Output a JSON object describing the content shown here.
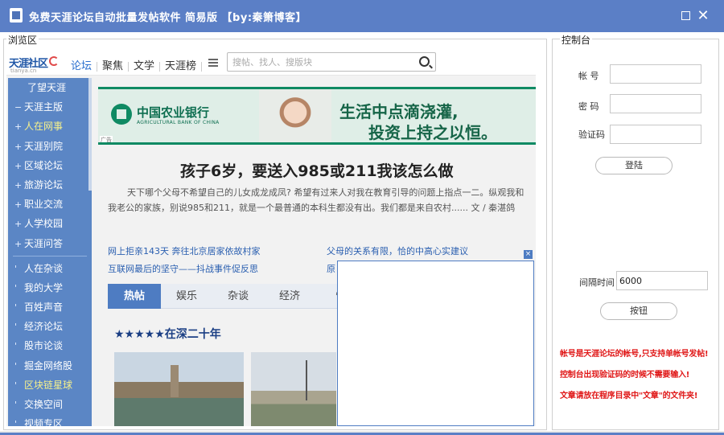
{
  "window": {
    "title": "免费天涯论坛自动批量发帖软件 简易版 【by:秦箫博客】",
    "maximize_icon": "maximize-icon",
    "close_icon": "close-icon"
  },
  "browse": {
    "group_label": "浏览区",
    "site": {
      "logo_text": "天涯社区",
      "logo_sub": "tianya.cn",
      "nav": [
        "论坛",
        "聚焦",
        "文学",
        "天涯榜"
      ],
      "search_placeholder": "搜帖、找人、搜版块"
    },
    "sidebar": {
      "items": [
        {
          "label": "了望天涯",
          "plus": "",
          "highlight": false
        },
        {
          "label": "天涯主版",
          "plus": "−",
          "highlight": false
        },
        {
          "label": "人在网事",
          "plus": "+",
          "highlight": true
        },
        {
          "label": "天涯别院",
          "plus": "+",
          "highlight": false
        },
        {
          "label": "区域论坛",
          "plus": "+",
          "highlight": false
        },
        {
          "label": "旅游论坛",
          "plus": "+",
          "highlight": false
        },
        {
          "label": "职业交流",
          "plus": "+",
          "highlight": false
        },
        {
          "label": "人学校园",
          "plus": "+",
          "highlight": false
        },
        {
          "label": "天涯问答",
          "plus": "+",
          "highlight": false
        }
      ],
      "items2": [
        {
          "label": "人在杂谈",
          "plus": "'",
          "highlight": false
        },
        {
          "label": "我的大学",
          "plus": "'",
          "highlight": false
        },
        {
          "label": "百姓声音",
          "plus": "'",
          "highlight": false
        },
        {
          "label": "经济论坛",
          "plus": "'",
          "highlight": false
        },
        {
          "label": "股市论谈",
          "plus": "'",
          "highlight": false
        },
        {
          "label": "掘金网络股",
          "plus": "'",
          "highlight": false
        },
        {
          "label": "区块链星球",
          "plus": "'",
          "highlight": true
        },
        {
          "label": "交换空间",
          "plus": "'",
          "highlight": false
        },
        {
          "label": "视频专区",
          "plus": "'",
          "highlight": false
        }
      ]
    },
    "banner": {
      "bank_name": "中国农业银行",
      "bank_en": "AGRICULTURAL BANK OF CHINA",
      "slogan1": "生活中点滴浇灌,",
      "slogan2": "投资上持之以恒。",
      "tag": "广告"
    },
    "article": {
      "headline": "孩子6岁，要送入985或211我该怎么做",
      "summary": "天下哪个父母不希望自己的儿女成龙成凤? 希望有过来人对我在教育引导的问题上指点一二。纵观我和我老公的家族，别说985和211，就是一个最普通的本科生都没有出。我们都是来自农村...... 文 / 秦湛鸽"
    },
    "links": [
      "网上拒亲143天 奔往北京居家依故村家",
      "父母的关系有限，恰的中高心实建议",
      "互联网最后的坚守——抖战事件促反思",
      "原"
    ],
    "tabs": [
      "热帖",
      "娱乐",
      "杂谈",
      "经济",
      "情"
    ],
    "section_title": "★★★★★在深二十年"
  },
  "control": {
    "group_label": "控制台",
    "account_label": "帐 号",
    "password_label": "密 码",
    "captcha_label": "验证码",
    "account_value": "",
    "password_value": "",
    "captcha_value": "",
    "login_button": "登陆",
    "interval_label": "间隔时间",
    "interval_value": "6000",
    "start_button": "按钮",
    "notes": [
      "帐号是天涯论坛的帐号,只支持单帐号发帖!",
      "控制台出现验证码的时候不需要输入!",
      "文章请放在程序目录中\"文章\"的文件夹!"
    ]
  },
  "colors": {
    "title_bar": "#5b7fc6",
    "sidebar": "#5b86c5",
    "note_red": "#e01818",
    "bank_green": "#0f8a63"
  }
}
